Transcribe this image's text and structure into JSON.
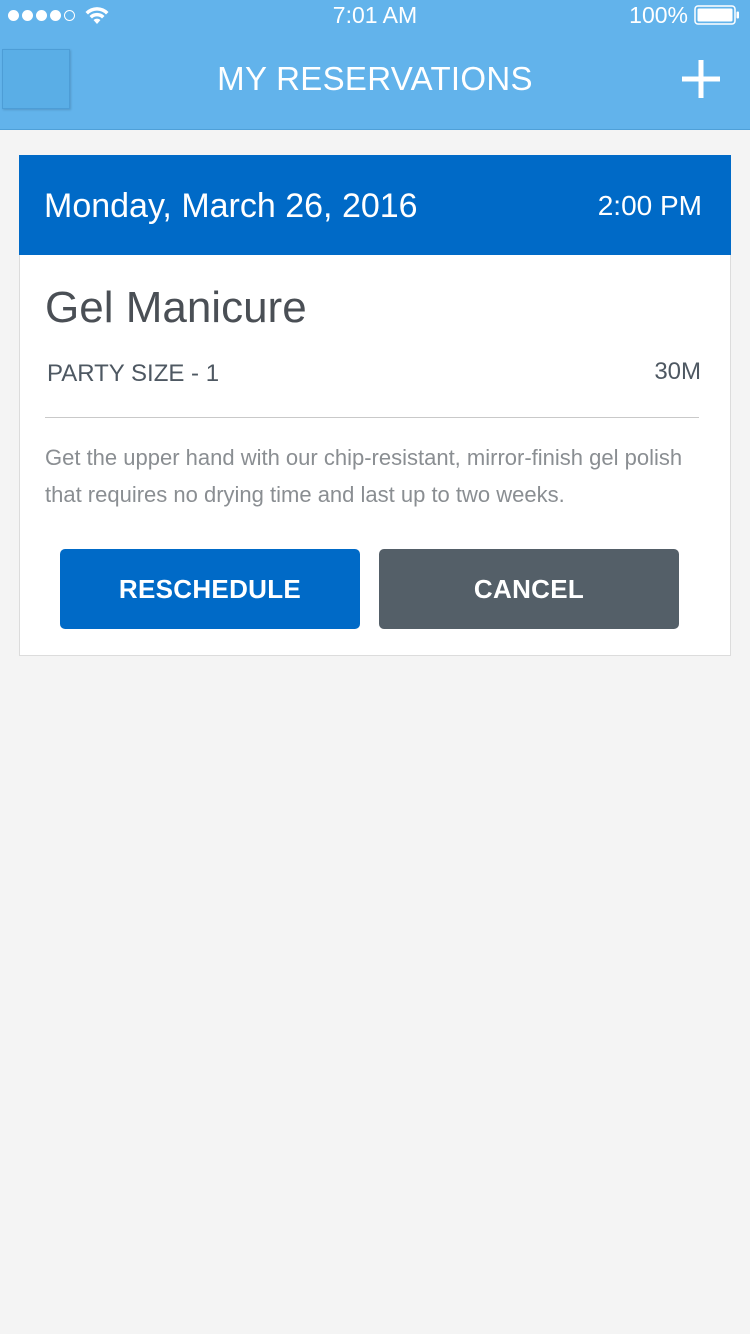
{
  "status_bar": {
    "time": "7:01 AM",
    "battery_percent": "100%",
    "signal_bars_filled": 4,
    "signal_bars_total": 5
  },
  "header": {
    "title": "MY RESERVATIONS",
    "background_color": "#62b3eb"
  },
  "reservation": {
    "date": "Monday, March 26, 2016",
    "time": "2:00 PM",
    "service": "Gel Manicure",
    "party_size": "PARTY SIZE - 1",
    "duration": "30M",
    "description": "Get the upper hand with our chip-resistant, mirror-finish gel polish that requires no drying time and last up to two weeks.",
    "header_color": "#006ac7"
  },
  "actions": {
    "reschedule_label": "RESCHEDULE",
    "cancel_label": "CANCEL",
    "reschedule_color": "#006ac7",
    "cancel_color": "#545f68"
  },
  "icons": {
    "menu": "menu-icon",
    "add": "plus-icon",
    "wifi": "wifi-icon",
    "battery": "battery-icon",
    "signal": "signal-icon"
  }
}
